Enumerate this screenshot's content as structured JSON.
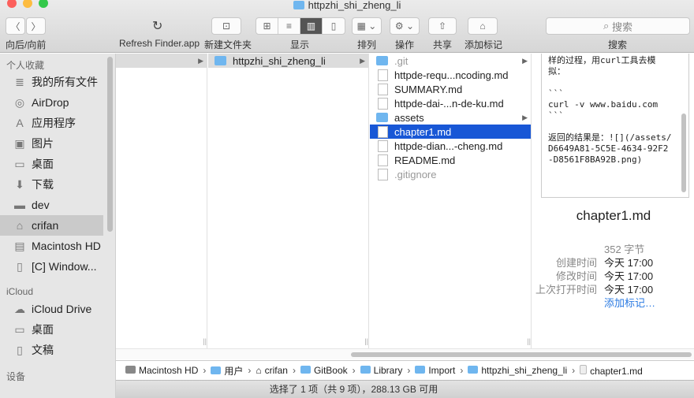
{
  "window": {
    "title": "httpzhi_shi_zheng_li"
  },
  "toolbar": {
    "nav_label": "向后/向前",
    "refresh_label": "Refresh Finder.app",
    "new_folder_label": "新建文件夹",
    "view_label": "显示",
    "arrange_label": "排列",
    "action_label": "操作",
    "share_label": "共享",
    "tag_label": "添加标记",
    "search_placeholder": "搜索",
    "search_label": "搜索"
  },
  "sidebar": {
    "favorites_title": "个人收藏",
    "favorites": [
      {
        "label": "我的所有文件",
        "icon": "≣"
      },
      {
        "label": "AirDrop",
        "icon": "◎"
      },
      {
        "label": "应用程序",
        "icon": "A"
      },
      {
        "label": "图片",
        "icon": "▣"
      },
      {
        "label": "桌面",
        "icon": "▭"
      },
      {
        "label": "下载",
        "icon": "⬇"
      },
      {
        "label": "dev",
        "icon": "▬"
      },
      {
        "label": "crifan",
        "icon": "⌂"
      },
      {
        "label": "Macintosh HD",
        "icon": "▤"
      },
      {
        "label": "[C] Window...",
        "icon": "▯"
      }
    ],
    "icloud_title": "iCloud",
    "icloud": [
      {
        "label": "iCloud Drive",
        "icon": "☁"
      },
      {
        "label": "桌面",
        "icon": "▭"
      },
      {
        "label": "文稿",
        "icon": "▯"
      }
    ],
    "devices_title": "设备"
  },
  "column2": {
    "item": "httpzhi_shi_zheng_li"
  },
  "column3": [
    {
      "name": ".git",
      "type": "folder",
      "dim": true
    },
    {
      "name": "httpde-requ...ncoding.md",
      "type": "file"
    },
    {
      "name": "SUMMARY.md",
      "type": "file"
    },
    {
      "name": "httpde-dai-...n-de-ku.md",
      "type": "file"
    },
    {
      "name": "assets",
      "type": "folder"
    },
    {
      "name": "chapter1.md",
      "type": "file",
      "selected": true
    },
    {
      "name": "httpde-dian...-cheng.md",
      "type": "file"
    },
    {
      "name": "README.md",
      "type": "file"
    },
    {
      "name": ".gitignore",
      "type": "file",
      "dim": true
    }
  ],
  "preview": {
    "text": "样的过程，用curl工具去模\n拟：\n\n```\ncurl -v www.baidu.com\n```\n\n返回的结果是：![](/assets/\nD6649A81-5C5E-4634-92F2\n-D8561F8BA92B.png)",
    "name": "chapter1.md",
    "size": "352 字节",
    "created_label": "创建时间",
    "created": "今天 17:00",
    "modified_label": "修改时间",
    "modified": "今天 17:00",
    "opened_label": "上次打开时间",
    "opened": "今天 17:00",
    "add_tag": "添加标记…"
  },
  "path": [
    "Macintosh HD",
    "用户",
    "crifan",
    "GitBook",
    "Library",
    "Import",
    "httpzhi_shi_zheng_li",
    "chapter1.md"
  ],
  "status": "选择了 1 项（共 9 项），288.13 GB 可用"
}
